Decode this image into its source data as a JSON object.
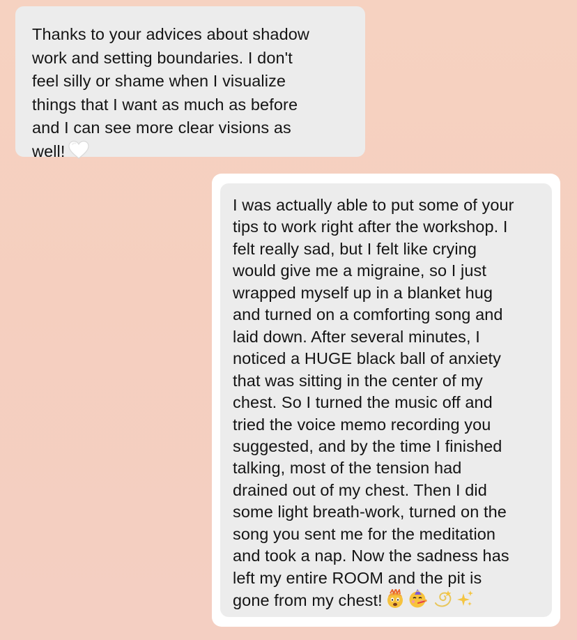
{
  "messages": [
    {
      "side": "left",
      "text": "Thanks to your advices about shadow\nwork and setting boundaries. I don't\nfeel silly or shame when I visualize\nthings that I want as much as before\nand I can see more clear visions as\nwell!",
      "emojis": [
        "white-heart"
      ]
    },
    {
      "side": "right",
      "text": "I was actually able to put some of your\ntips to work right after the workshop. I\nfelt really sad, but I felt like crying\nwould give me a migraine, so I just\nwrapped myself up in a blanket hug\nand turned on a comforting song and\nlaid down. After several minutes, I\nnoticed a HUGE black ball of anxiety\nthat was sitting in the center of my\nchest. So I turned the music off and\ntried the voice memo recording you\nsuggested, and by the time I finished\ntalking, most of the tension had\ndrained out of my chest. Then I did\nsome light breath-work, turned on the\nsong you sent me for the meditation\nand took a nap. Now the sadness has\nleft my entire ROOM and the pit is\ngone from my chest!",
      "emojis": [
        "exploding-head",
        "partying-face",
        "dizzy",
        "sparkles"
      ]
    }
  ],
  "colors": {
    "background": "#f6d2c1",
    "bubble": "#ececec",
    "card": "#ffffff",
    "text": "#141414"
  }
}
